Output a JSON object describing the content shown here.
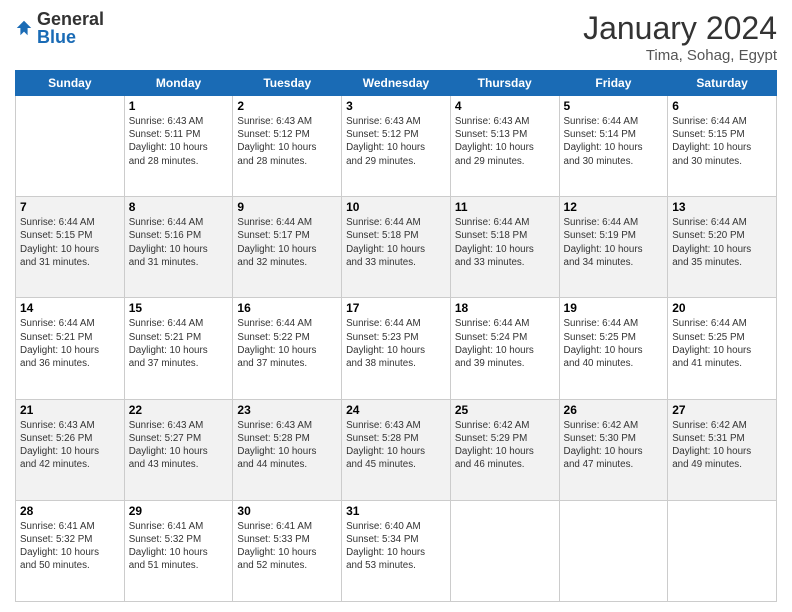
{
  "header": {
    "logo_general": "General",
    "logo_blue": "Blue",
    "month_title": "January 2024",
    "location": "Tima, Sohag, Egypt"
  },
  "days_of_week": [
    "Sunday",
    "Monday",
    "Tuesday",
    "Wednesday",
    "Thursday",
    "Friday",
    "Saturday"
  ],
  "weeks": [
    [
      {
        "day": "",
        "info": ""
      },
      {
        "day": "1",
        "info": "Sunrise: 6:43 AM\nSunset: 5:11 PM\nDaylight: 10 hours\nand 28 minutes."
      },
      {
        "day": "2",
        "info": "Sunrise: 6:43 AM\nSunset: 5:12 PM\nDaylight: 10 hours\nand 28 minutes."
      },
      {
        "day": "3",
        "info": "Sunrise: 6:43 AM\nSunset: 5:12 PM\nDaylight: 10 hours\nand 29 minutes."
      },
      {
        "day": "4",
        "info": "Sunrise: 6:43 AM\nSunset: 5:13 PM\nDaylight: 10 hours\nand 29 minutes."
      },
      {
        "day": "5",
        "info": "Sunrise: 6:44 AM\nSunset: 5:14 PM\nDaylight: 10 hours\nand 30 minutes."
      },
      {
        "day": "6",
        "info": "Sunrise: 6:44 AM\nSunset: 5:15 PM\nDaylight: 10 hours\nand 30 minutes."
      }
    ],
    [
      {
        "day": "7",
        "info": "Sunrise: 6:44 AM\nSunset: 5:15 PM\nDaylight: 10 hours\nand 31 minutes."
      },
      {
        "day": "8",
        "info": "Sunrise: 6:44 AM\nSunset: 5:16 PM\nDaylight: 10 hours\nand 31 minutes."
      },
      {
        "day": "9",
        "info": "Sunrise: 6:44 AM\nSunset: 5:17 PM\nDaylight: 10 hours\nand 32 minutes."
      },
      {
        "day": "10",
        "info": "Sunrise: 6:44 AM\nSunset: 5:18 PM\nDaylight: 10 hours\nand 33 minutes."
      },
      {
        "day": "11",
        "info": "Sunrise: 6:44 AM\nSunset: 5:18 PM\nDaylight: 10 hours\nand 33 minutes."
      },
      {
        "day": "12",
        "info": "Sunrise: 6:44 AM\nSunset: 5:19 PM\nDaylight: 10 hours\nand 34 minutes."
      },
      {
        "day": "13",
        "info": "Sunrise: 6:44 AM\nSunset: 5:20 PM\nDaylight: 10 hours\nand 35 minutes."
      }
    ],
    [
      {
        "day": "14",
        "info": "Sunrise: 6:44 AM\nSunset: 5:21 PM\nDaylight: 10 hours\nand 36 minutes."
      },
      {
        "day": "15",
        "info": "Sunrise: 6:44 AM\nSunset: 5:21 PM\nDaylight: 10 hours\nand 37 minutes."
      },
      {
        "day": "16",
        "info": "Sunrise: 6:44 AM\nSunset: 5:22 PM\nDaylight: 10 hours\nand 37 minutes."
      },
      {
        "day": "17",
        "info": "Sunrise: 6:44 AM\nSunset: 5:23 PM\nDaylight: 10 hours\nand 38 minutes."
      },
      {
        "day": "18",
        "info": "Sunrise: 6:44 AM\nSunset: 5:24 PM\nDaylight: 10 hours\nand 39 minutes."
      },
      {
        "day": "19",
        "info": "Sunrise: 6:44 AM\nSunset: 5:25 PM\nDaylight: 10 hours\nand 40 minutes."
      },
      {
        "day": "20",
        "info": "Sunrise: 6:44 AM\nSunset: 5:25 PM\nDaylight: 10 hours\nand 41 minutes."
      }
    ],
    [
      {
        "day": "21",
        "info": "Sunrise: 6:43 AM\nSunset: 5:26 PM\nDaylight: 10 hours\nand 42 minutes."
      },
      {
        "day": "22",
        "info": "Sunrise: 6:43 AM\nSunset: 5:27 PM\nDaylight: 10 hours\nand 43 minutes."
      },
      {
        "day": "23",
        "info": "Sunrise: 6:43 AM\nSunset: 5:28 PM\nDaylight: 10 hours\nand 44 minutes."
      },
      {
        "day": "24",
        "info": "Sunrise: 6:43 AM\nSunset: 5:28 PM\nDaylight: 10 hours\nand 45 minutes."
      },
      {
        "day": "25",
        "info": "Sunrise: 6:42 AM\nSunset: 5:29 PM\nDaylight: 10 hours\nand 46 minutes."
      },
      {
        "day": "26",
        "info": "Sunrise: 6:42 AM\nSunset: 5:30 PM\nDaylight: 10 hours\nand 47 minutes."
      },
      {
        "day": "27",
        "info": "Sunrise: 6:42 AM\nSunset: 5:31 PM\nDaylight: 10 hours\nand 49 minutes."
      }
    ],
    [
      {
        "day": "28",
        "info": "Sunrise: 6:41 AM\nSunset: 5:32 PM\nDaylight: 10 hours\nand 50 minutes."
      },
      {
        "day": "29",
        "info": "Sunrise: 6:41 AM\nSunset: 5:32 PM\nDaylight: 10 hours\nand 51 minutes."
      },
      {
        "day": "30",
        "info": "Sunrise: 6:41 AM\nSunset: 5:33 PM\nDaylight: 10 hours\nand 52 minutes."
      },
      {
        "day": "31",
        "info": "Sunrise: 6:40 AM\nSunset: 5:34 PM\nDaylight: 10 hours\nand 53 minutes."
      },
      {
        "day": "",
        "info": ""
      },
      {
        "day": "",
        "info": ""
      },
      {
        "day": "",
        "info": ""
      }
    ]
  ]
}
